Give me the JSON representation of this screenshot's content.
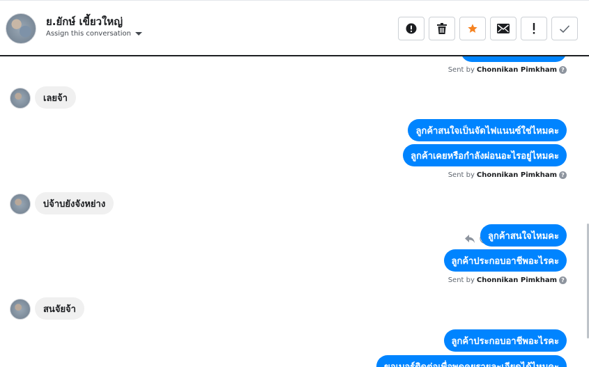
{
  "header": {
    "contact_name": "ย.ยักษ์ เขี้ยวใหญ่",
    "assign_label": "Assign this conversation",
    "toolbar": [
      {
        "name": "spam-button",
        "icon": "alert-circle-icon"
      },
      {
        "name": "delete-button",
        "icon": "trash-icon"
      },
      {
        "name": "star-button",
        "icon": "star-icon"
      },
      {
        "name": "mark-unread-button",
        "icon": "envelope-icon"
      },
      {
        "name": "follow-up-button",
        "icon": "exclamation-icon"
      },
      {
        "name": "mark-done-button",
        "icon": "check-icon"
      }
    ],
    "accent_star": "#f58220"
  },
  "conversation": {
    "sent_by_prefix": "Sent by",
    "sent_by_name": "Chonnikan Pimkham",
    "help_glyph": "?",
    "messages": [
      {
        "dir": "in",
        "text": "เลยจ้า"
      },
      {
        "dir": "out",
        "text": "ลูกค้าสนใจเป็นจัดไฟแนนซ์ใช่ไหมคะ"
      },
      {
        "dir": "out",
        "text": "ลูกค้าเคยหรือกำลังผ่อนอะไรอยู่ไหมคะ"
      },
      {
        "dir": "in",
        "text": "บ่จ้าบยังจังหย่าง"
      },
      {
        "dir": "out",
        "text": "ลูกค้าสนใจไหมคะ"
      },
      {
        "dir": "out",
        "text": "ลูกค้าประกอบอาชีพอะไรคะ"
      },
      {
        "dir": "in",
        "text": "สนจัยจ้า"
      },
      {
        "dir": "out",
        "text": "ลูกค้าประกอบอาชีพอะไรคะ"
      },
      {
        "dir": "out",
        "text": "ขอเบอร์ติดต่อเพื่อพูดคุยรายละเอียดได้ไหมคะ"
      }
    ]
  },
  "colors": {
    "outgoing_bubble": "#0084ff",
    "incoming_bubble": "#f0f0f0"
  }
}
